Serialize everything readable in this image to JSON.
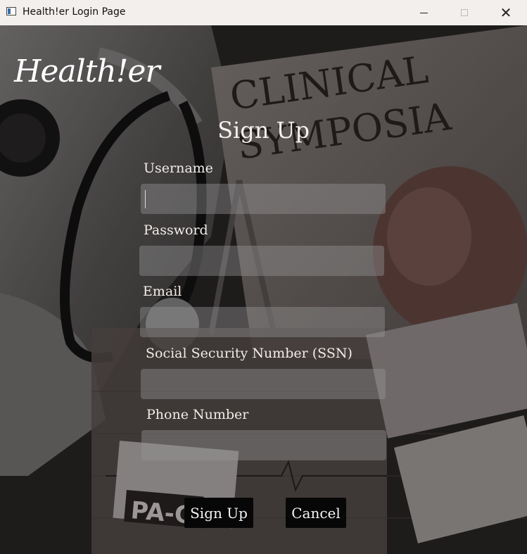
{
  "window": {
    "title": "Health!er Login Page"
  },
  "brand": {
    "logo": "Health!er"
  },
  "form": {
    "heading": "Sign Up",
    "fields": [
      {
        "label": "Username",
        "value": ""
      },
      {
        "label": "Password",
        "value": ""
      },
      {
        "label": "Email",
        "value": ""
      },
      {
        "label": "Social Security Number (SSN)",
        "value": ""
      },
      {
        "label": "Phone Number",
        "value": ""
      }
    ],
    "signup_label": "Sign Up",
    "cancel_label": "Cancel"
  },
  "background": {
    "poster_text_1": "CLINICAL",
    "poster_text_2": "SYMPOSIA",
    "badge_text": "PA-C"
  },
  "colors": {
    "button": "#070707",
    "field": "#8f8f8f",
    "text": "#f1ece8"
  }
}
